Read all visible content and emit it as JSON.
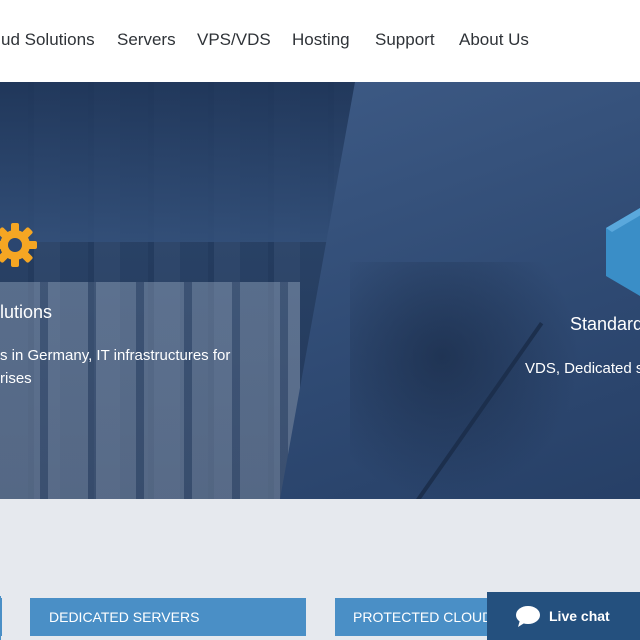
{
  "nav": {
    "items": [
      "ud Solutions",
      "Servers",
      "VPS/VDS",
      "Hosting",
      "Support",
      "About Us"
    ]
  },
  "hero": {
    "left_title": "lutions",
    "left_text_line1": "s in Germany, IT infrastructures for",
    "left_text_line2": "rises",
    "right_title": "Standard",
    "right_text": "VDS, Dedicated s"
  },
  "cards": {
    "dedicated": "DEDICATED SERVERS",
    "protected": "PROTECTED CLOUD"
  },
  "chat": {
    "label": "Live chat"
  },
  "colors": {
    "accent": "#4a8fc6",
    "gear": "#f5a623",
    "cube": "#3a8ec7",
    "chat_bg": "#24507e"
  }
}
